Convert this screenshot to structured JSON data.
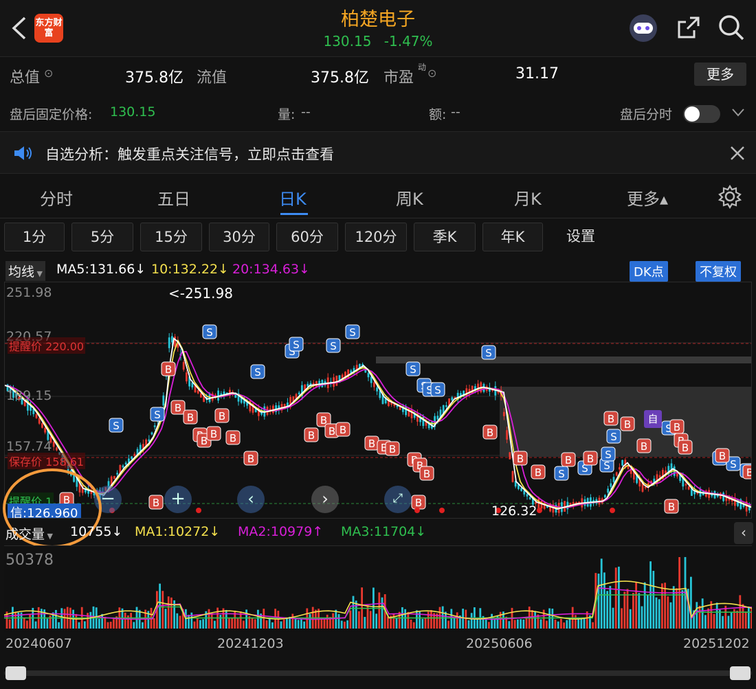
{
  "header": {
    "title": "柏楚电子",
    "price": "130.15",
    "change": "-1.47%",
    "logo_text": "东方财富",
    "back_icon": "back-chevron-icon",
    "robot_icon": "robot-assistant-icon",
    "share_icon": "share-icon",
    "search_icon": "search-icon"
  },
  "stats": {
    "total_cap_label": "总值",
    "total_cap_value": "375.8亿",
    "float_cap_label": "流值",
    "float_cap_value": "375.8亿",
    "pe_label": "市盈",
    "pe_sup": "动",
    "pe_value": "31.17",
    "more_label": "更多"
  },
  "after_hours": {
    "fixed_price_label": "盘后固定价格:",
    "fixed_price_value": "130.15",
    "volume_label": "量:",
    "volume_value": "--",
    "amount_label": "额:",
    "amount_value": "--",
    "timeshare_label": "盘后分时"
  },
  "notice": {
    "text": "自选分析：触发重点关注信号，立即点击查看"
  },
  "tabs": [
    {
      "label": "分时"
    },
    {
      "label": "五日"
    },
    {
      "label": "日K"
    },
    {
      "label": "周K"
    },
    {
      "label": "月K"
    },
    {
      "label": "更多▴"
    }
  ],
  "periods": [
    {
      "label": "1分"
    },
    {
      "label": "5分"
    },
    {
      "label": "15分"
    },
    {
      "label": "30分"
    },
    {
      "label": "60分"
    },
    {
      "label": "120分"
    },
    {
      "label": "季K"
    },
    {
      "label": "年K"
    },
    {
      "label": "设置"
    }
  ],
  "ma_bar": {
    "selector": "均线",
    "ma5": "MA5:131.66↓",
    "ma10": "10:132.22↓",
    "ma20": "20:134.63↓",
    "dk_button": "DK点",
    "adjust_button": "不复权"
  },
  "chart_labels": {
    "top_price": "251.98",
    "level_220": "220.57",
    "level_189": "189.15",
    "level_157": "157.74",
    "high_marker": "<-251.98",
    "low_marker": "126.32",
    "alert_line": "提醒价 220.00",
    "stop_line": "保存价 158.61",
    "cost_line": "提醒价 1",
    "cursor_value": "信:126.960",
    "self_marker": "自"
  },
  "vol_bar": {
    "selector": "成交量",
    "current": "10755↓",
    "ma1": "MA1:10272↓",
    "ma2": "MA2:10979↑",
    "ma3": "MA3:11704↓"
  },
  "vol_labels": {
    "max": "50378"
  },
  "dates": [
    "20240607",
    "20241203",
    "20250606",
    "20251202"
  ],
  "colors": {
    "up": "#e8392f",
    "down": "#27c4d6",
    "ma5": "#ffffff",
    "ma10": "#f4e04d",
    "ma20": "#d81fd8",
    "accent": "#3d8bf2",
    "title": "#f5a623",
    "green": "#2fbf4f"
  }
}
